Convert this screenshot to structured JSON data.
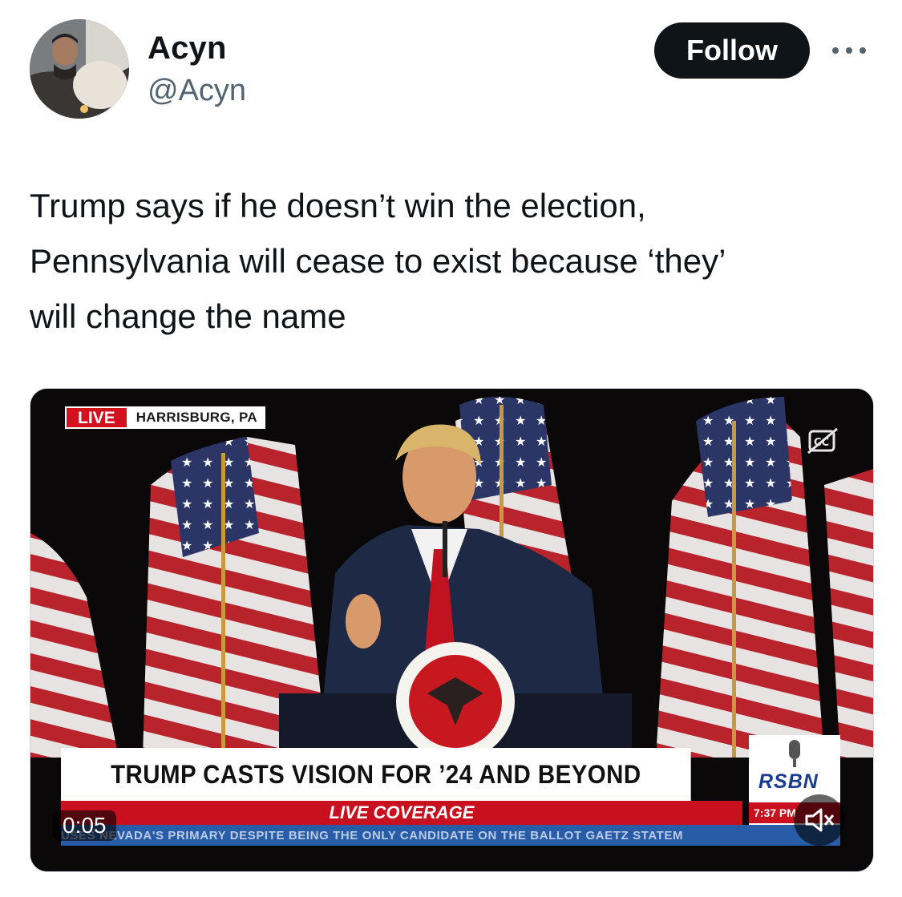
{
  "author": {
    "name": "Acyn",
    "handle": "@Acyn",
    "avatar_icon": "profile-photo"
  },
  "follow_label": "Follow",
  "more_icon": "more-horizontal-icon",
  "tweet": {
    "text_lines": [
      "Trump says if he doesn’t win the election,",
      "Pennsylvania will cease to exist because ‘they’",
      "will change the name"
    ]
  },
  "video": {
    "live_badge": "LIVE",
    "location": "HARRISBURG, PA",
    "headline": "TRUMP CASTS VISION FOR ’24 AND BEYOND",
    "coverage": "LIVE COVERAGE",
    "ticker": "USES NEVADA'S PRIMARY DESPITE BEING THE ONLY CANDIDATE ON THE BALLOT     GAETZ STATEM",
    "network": "RSBN",
    "network_time": "7:37 PM",
    "timestamp": "0:05",
    "cc_icon": "closed-captions-off-icon",
    "mute_icon": "volume-muted-icon"
  }
}
